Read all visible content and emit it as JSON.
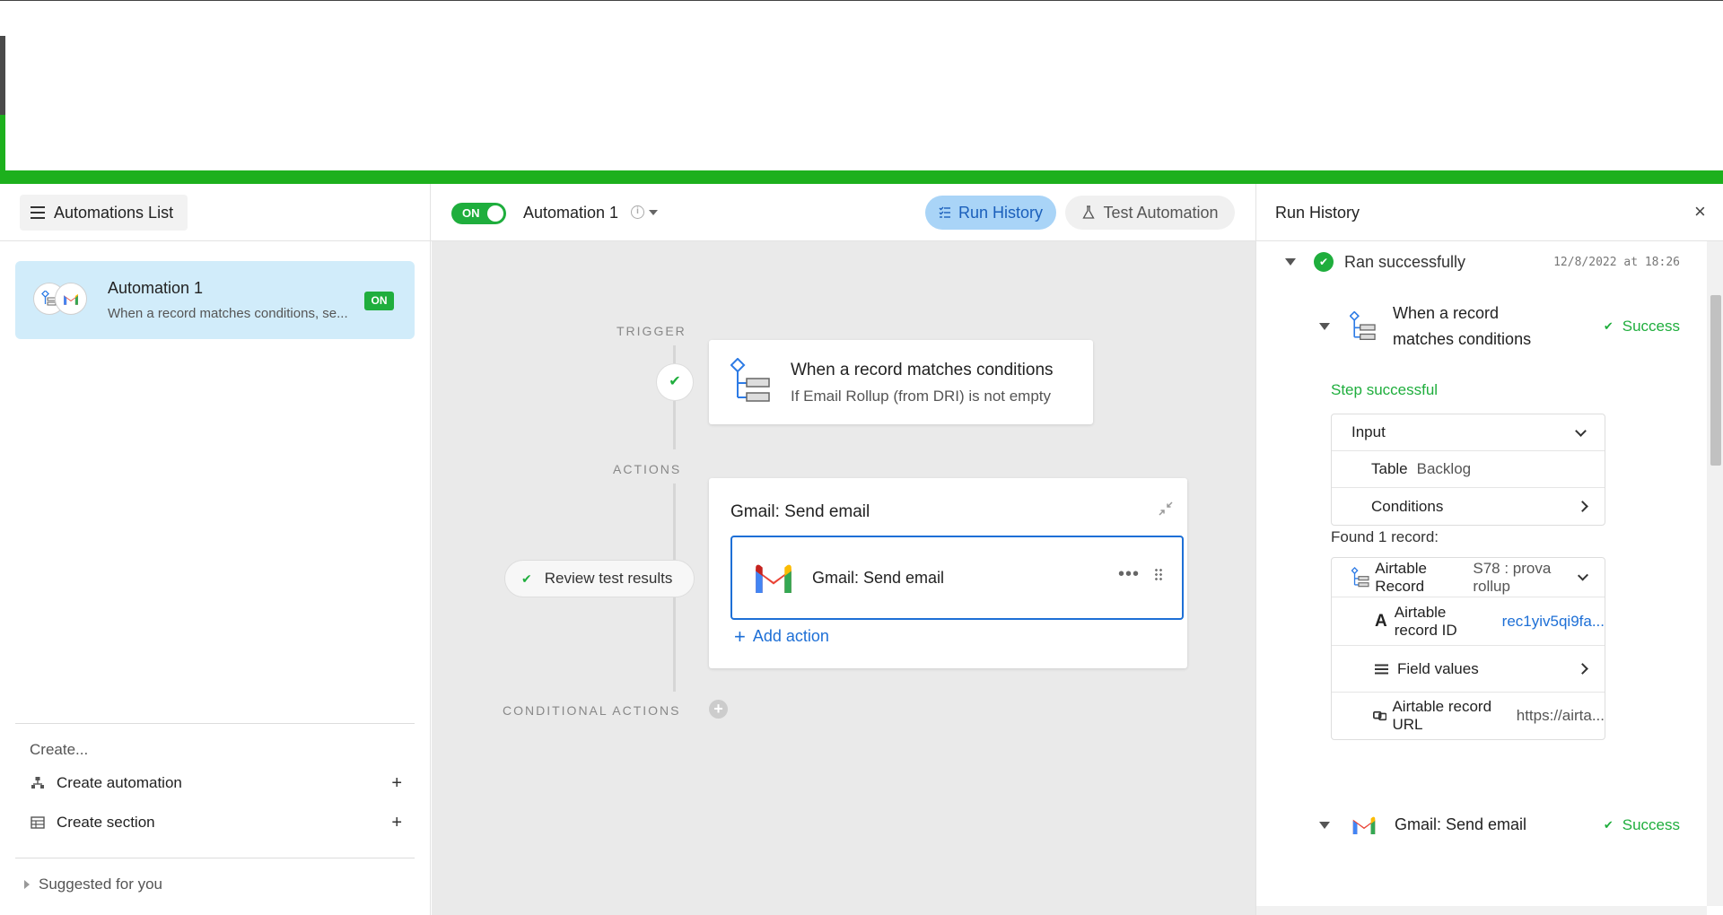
{
  "header": {
    "automations_list_label": "Automations List",
    "toggle_label": "ON",
    "automation_title": "Automation 1",
    "run_history_label": "Run History",
    "test_automation_label": "Test Automation",
    "panel_title": "Run History",
    "close_glyph": "×"
  },
  "sidebar": {
    "automation": {
      "title": "Automation 1",
      "subtitle": "When a record matches conditions, se...",
      "badge": "ON"
    },
    "create_label": "Create...",
    "create_automation": "Create automation",
    "create_section": "Create section",
    "plus": "+",
    "suggested": "Suggested for you"
  },
  "canvas": {
    "trigger_label": "TRIGGER",
    "actions_label": "ACTIONS",
    "conditional_label": "CONDITIONAL ACTIONS",
    "trigger_title": "When a record matches conditions",
    "trigger_subtitle": "If Email Rollup (from DRI) is not empty",
    "review_label": "Review test results",
    "action_group_title": "Gmail: Send email",
    "action_item_label": "Gmail: Send email",
    "add_action_label": "Add action",
    "dots": "•••"
  },
  "run_history": {
    "ran_label": "Ran successfully",
    "timestamp": "12/8/2022 at 18:26",
    "step1_name_line1": "When a record",
    "step1_name_line2": "matches conditions",
    "success_label": "Success",
    "step_successful": "Step successful",
    "input_label": "Input",
    "table_key": "Table",
    "table_value": "Backlog",
    "conditions_label": "Conditions",
    "found_label": "Found 1 record:",
    "record_label": "Airtable Record",
    "record_value": "S78 : prova rollup",
    "record_id_key": "Airtable record ID",
    "record_id_value": "rec1yiv5qi9fa...",
    "field_values_label": "Field values",
    "record_url_key": "Airtable record URL",
    "record_url_value": "https://airta...",
    "step2_name": "Gmail: Send email",
    "success_label_2": "Success"
  },
  "colors": {
    "accent_green": "#1fae3d",
    "accent_blue": "#1d6fd6",
    "selected_card": "#d1ecfa",
    "run_history_bg": "#a9d4f7",
    "browser_green": "#1db01d"
  }
}
